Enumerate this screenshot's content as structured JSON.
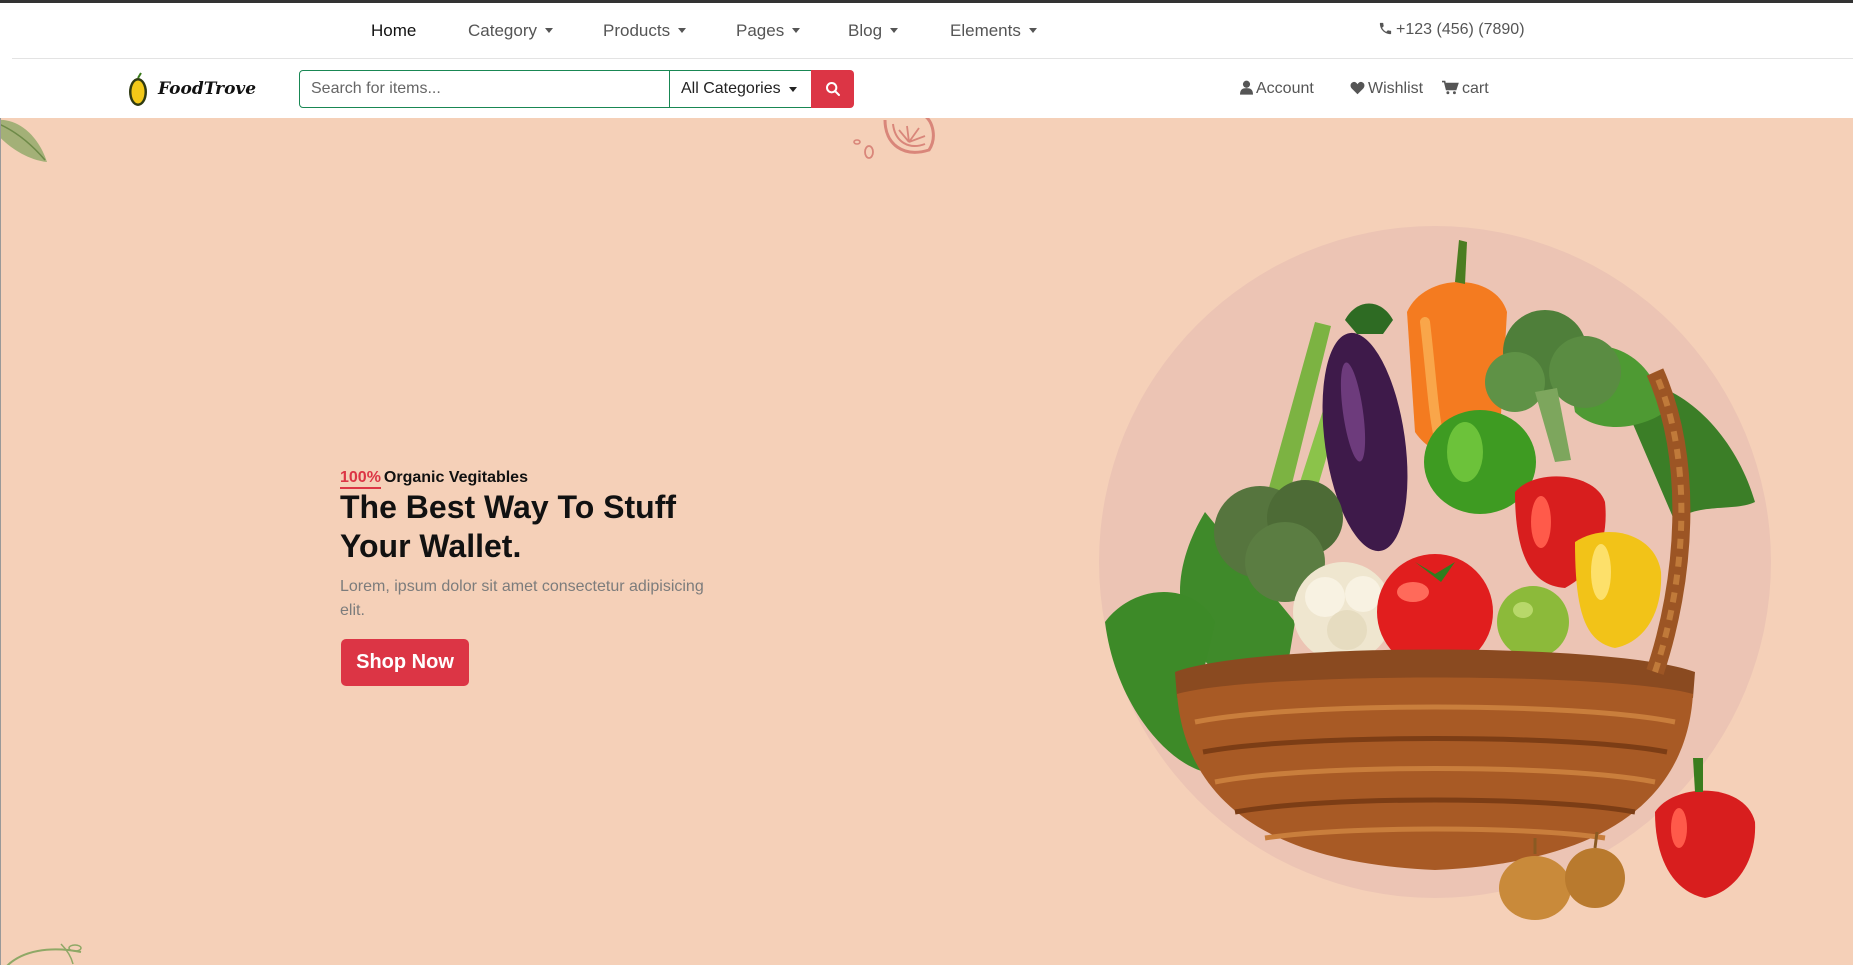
{
  "topnav": {
    "items": [
      {
        "label": "Home",
        "dropdown": false,
        "active": true
      },
      {
        "label": "Category",
        "dropdown": true,
        "active": false
      },
      {
        "label": "Products",
        "dropdown": true,
        "active": false
      },
      {
        "label": "Pages",
        "dropdown": true,
        "active": false
      },
      {
        "label": "Blog",
        "dropdown": true,
        "active": false
      },
      {
        "label": "Elements",
        "dropdown": true,
        "active": false
      }
    ],
    "phone": "+123 (456) (7890)",
    "phone_icon": "phone-icon"
  },
  "header": {
    "logo_text": "FoodTrove",
    "search_placeholder": "Search for items...",
    "category_select": "All Categories",
    "search_icon": "search-icon",
    "links": {
      "account": "Account",
      "wishlist": "Wishlist",
      "cart": "cart"
    }
  },
  "hero": {
    "tag_percent": "100%",
    "tag_text": "Organic Vegitables",
    "headline": "The Best Way To Stuff Your Wallet.",
    "description": "Lorem, ipsum dolor sit amet consectetur adipisicing elit.",
    "cta": "Shop Now"
  },
  "colors": {
    "accent": "#dc3545",
    "hero_bg": "#f5d0b8",
    "search_border": "#198754"
  }
}
